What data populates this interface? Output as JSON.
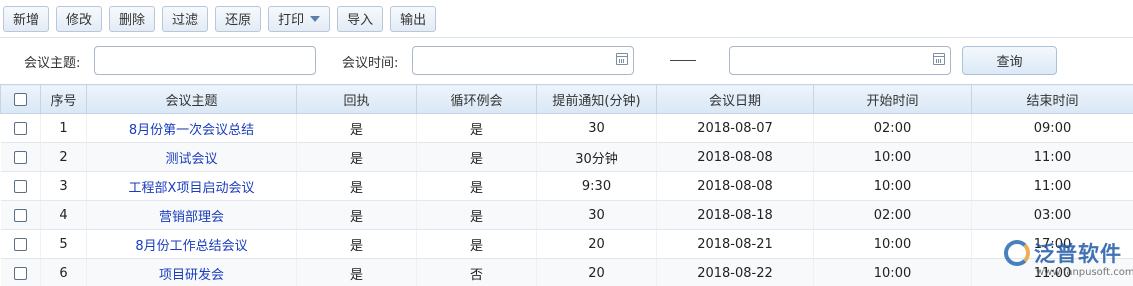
{
  "toolbar": {
    "buttons": [
      "新增",
      "修改",
      "删除",
      "过滤",
      "还原",
      "打印",
      "导入",
      "输出"
    ]
  },
  "search": {
    "topic_label": "会议主题:",
    "topic_value": "",
    "time_label": "会议时间:",
    "start_value": "",
    "end_value": "",
    "query_label": "查询"
  },
  "table": {
    "headers": [
      "序号",
      "会议主题",
      "回执",
      "循环例会",
      "提前通知(分钟)",
      "会议日期",
      "开始时间",
      "结束时间"
    ],
    "rows": [
      [
        "1",
        "8月份第一次会议总结",
        "是",
        "是",
        "30",
        "2018-08-07",
        "02:00",
        "09:00"
      ],
      [
        "2",
        "测试会议",
        "是",
        "是",
        "30分钟",
        "2018-08-08",
        "10:00",
        "11:00"
      ],
      [
        "3",
        "工程部X项目启动会议",
        "是",
        "是",
        "9:30",
        "2018-08-08",
        "10:00",
        "11:00"
      ],
      [
        "4",
        "营销部理会",
        "是",
        "是",
        "30",
        "2018-08-18",
        "02:00",
        "03:00"
      ],
      [
        "5",
        "8月份工作总结会议",
        "是",
        "是",
        "20",
        "2018-08-21",
        "10:00",
        "17:00"
      ],
      [
        "6",
        "项目研发会",
        "是",
        "否",
        "20",
        "2018-08-22",
        "10:00",
        "11:00"
      ]
    ]
  },
  "watermark": {
    "brand": "泛普软件",
    "url": "www.fanpusoft.com"
  },
  "colors": {
    "header_bg": "#dce9f6",
    "topic_link": "#1a3dbd",
    "border": "#c5d5e6"
  }
}
